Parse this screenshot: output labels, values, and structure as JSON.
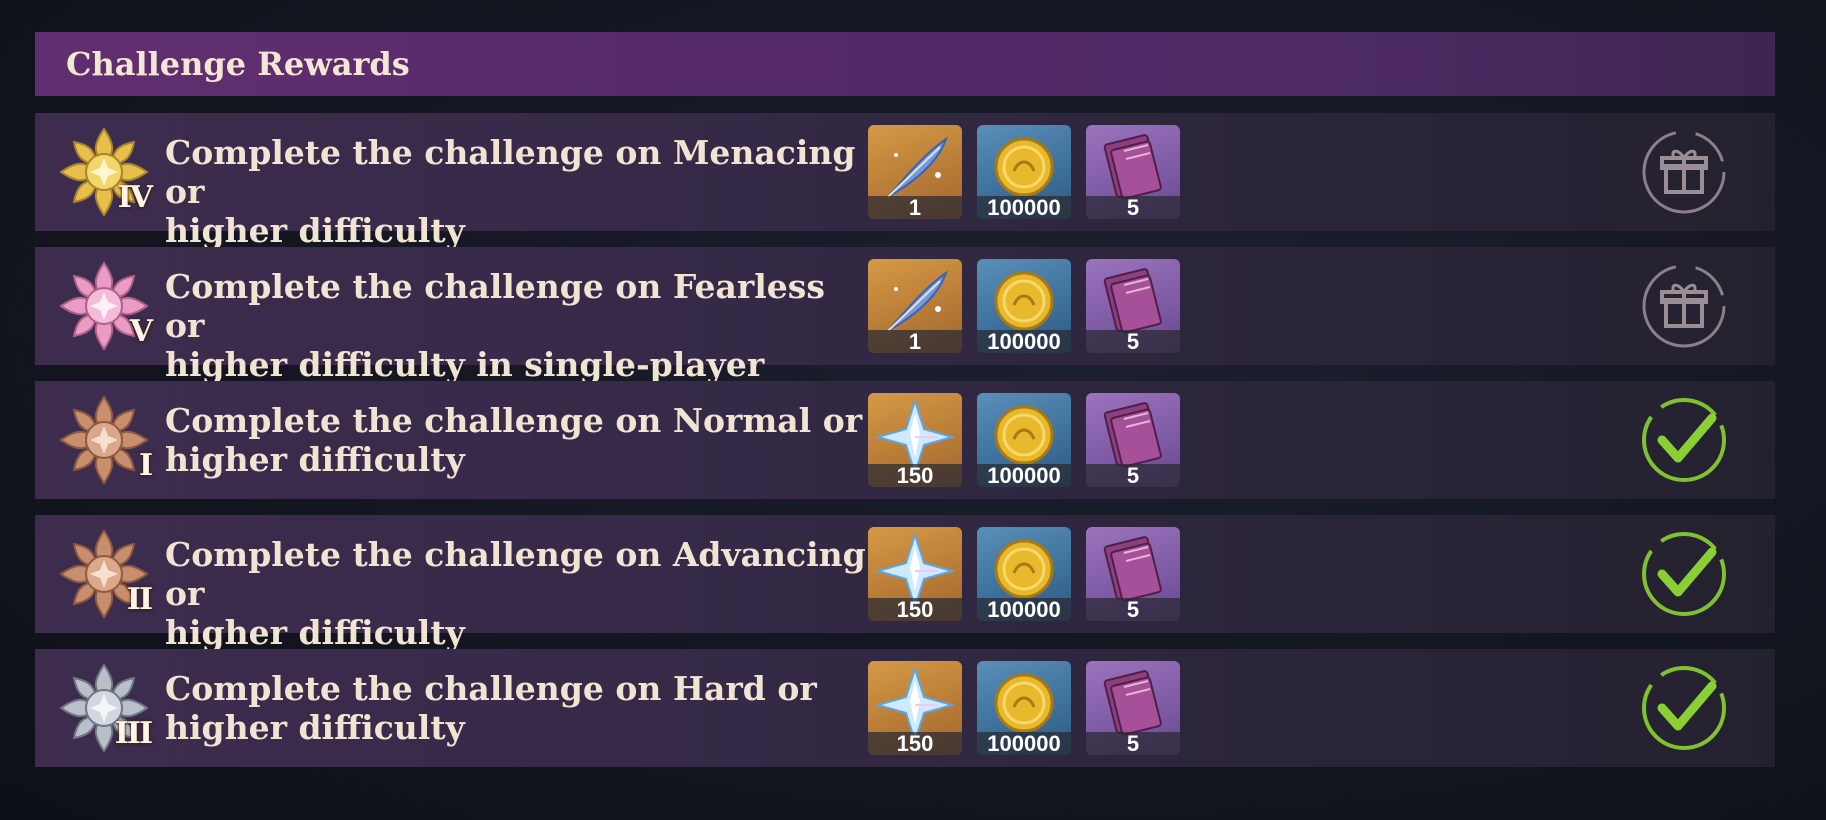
{
  "title": "Challenge Rewards",
  "colors": {
    "header": "#612f6f",
    "row": "#362a48",
    "gold": "#e6c04a",
    "pink": "#e99cc4",
    "bronze": "#c98e6e",
    "silver": "#b9c0ca",
    "checkGreen": "#7fc12f",
    "giftGrey": "#8c7f87"
  },
  "rows": [
    {
      "badge_color": "gold",
      "badge_numeral": "IV",
      "line1": "Complete the challenge on Menacing or",
      "line2": "higher difficulty",
      "rewards": [
        {
          "icon": "feather-icon",
          "count": "1"
        },
        {
          "icon": "mora-coin-icon",
          "count": "100000"
        },
        {
          "icon": "book-icon",
          "count": "5"
        }
      ],
      "status": "unclaimed-gift-icon"
    },
    {
      "badge_color": "pink",
      "badge_numeral": "V",
      "line1": "Complete the challenge on Fearless or",
      "line2": "higher difficulty in single-player mode",
      "rewards": [
        {
          "icon": "feather-icon",
          "count": "1"
        },
        {
          "icon": "mora-coin-icon",
          "count": "100000"
        },
        {
          "icon": "book-icon",
          "count": "5"
        }
      ],
      "status": "unclaimed-gift-icon"
    },
    {
      "badge_color": "bronze",
      "badge_numeral": "I",
      "line1": "Complete the challenge on Normal or",
      "line2": "higher difficulty",
      "rewards": [
        {
          "icon": "primogem-icon",
          "count": "150"
        },
        {
          "icon": "mora-coin-icon",
          "count": "100000"
        },
        {
          "icon": "book-icon",
          "count": "5"
        }
      ],
      "status": "claimed-check-icon"
    },
    {
      "badge_color": "bronze",
      "badge_numeral": "II",
      "line1": "Complete the challenge on Advancing or",
      "line2": "higher difficulty",
      "rewards": [
        {
          "icon": "primogem-icon",
          "count": "150"
        },
        {
          "icon": "mora-coin-icon",
          "count": "100000"
        },
        {
          "icon": "book-icon",
          "count": "5"
        }
      ],
      "status": "claimed-check-icon"
    },
    {
      "badge_color": "silver",
      "badge_numeral": "III",
      "line1": "Complete the challenge on Hard or",
      "line2": "higher difficulty",
      "rewards": [
        {
          "icon": "primogem-icon",
          "count": "150"
        },
        {
          "icon": "mora-coin-icon",
          "count": "100000"
        },
        {
          "icon": "book-icon",
          "count": "5"
        }
      ],
      "status": "claimed-check-icon"
    }
  ]
}
